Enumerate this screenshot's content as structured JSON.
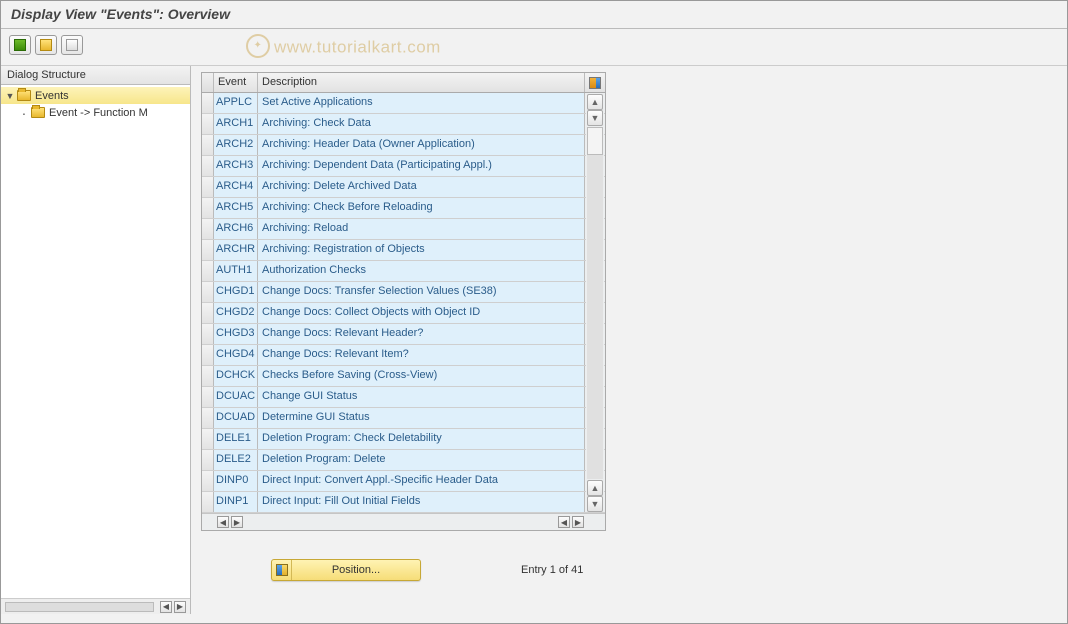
{
  "title": "Display View \"Events\": Overview",
  "watermark": "www.tutorialkart.com",
  "tree": {
    "header": "Dialog Structure",
    "root": {
      "label": "Events",
      "expanded": true
    },
    "child": {
      "label": "Event -> Function M"
    }
  },
  "table": {
    "columns": {
      "event": "Event",
      "description": "Description"
    },
    "rows": [
      {
        "event": "APPLC",
        "desc": "Set Active Applications"
      },
      {
        "event": "ARCH1",
        "desc": "Archiving: Check Data"
      },
      {
        "event": "ARCH2",
        "desc": "Archiving: Header Data (Owner Application)"
      },
      {
        "event": "ARCH3",
        "desc": "Archiving: Dependent Data (Participating Appl.)"
      },
      {
        "event": "ARCH4",
        "desc": "Archiving: Delete Archived Data"
      },
      {
        "event": "ARCH5",
        "desc": "Archiving: Check Before Reloading"
      },
      {
        "event": "ARCH6",
        "desc": "Archiving: Reload"
      },
      {
        "event": "ARCHR",
        "desc": "Archiving: Registration of Objects"
      },
      {
        "event": "AUTH1",
        "desc": "Authorization Checks"
      },
      {
        "event": "CHGD1",
        "desc": "Change Docs: Transfer Selection Values (SE38)"
      },
      {
        "event": "CHGD2",
        "desc": "Change Docs: Collect Objects with Object ID"
      },
      {
        "event": "CHGD3",
        "desc": "Change Docs: Relevant Header?"
      },
      {
        "event": "CHGD4",
        "desc": "Change Docs: Relevant Item?"
      },
      {
        "event": "DCHCK",
        "desc": "Checks Before Saving (Cross-View)"
      },
      {
        "event": "DCUAC",
        "desc": "Change GUI Status"
      },
      {
        "event": "DCUAD",
        "desc": "Determine GUI Status"
      },
      {
        "event": "DELE1",
        "desc": "Deletion Program: Check Deletability"
      },
      {
        "event": "DELE2",
        "desc": "Deletion Program: Delete"
      },
      {
        "event": "DINP0",
        "desc": "Direct Input: Convert Appl.-Specific Header Data"
      },
      {
        "event": "DINP1",
        "desc": "Direct Input: Fill Out Initial Fields"
      }
    ]
  },
  "footer": {
    "position_label": "Position...",
    "entry_label": "Entry 1 of 41"
  }
}
